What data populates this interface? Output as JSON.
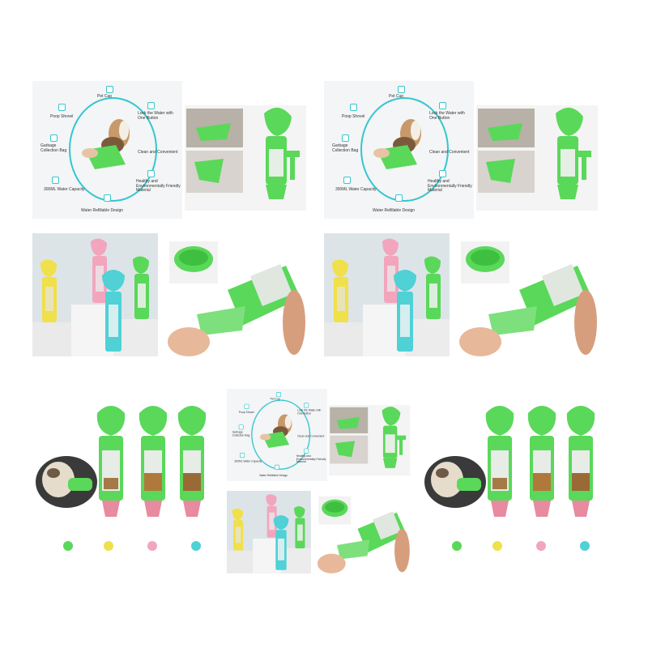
{
  "colors": {
    "green": "#5ad85a",
    "yellow": "#f0e04a",
    "pink": "#f2a6bd",
    "teal": "#4fd1d6",
    "accent": "#35c6cf"
  },
  "features": {
    "pet_cup": "Pet Cup",
    "lock_water": "Lock the Water with One Button",
    "poop_shovel": "Poop Shovel",
    "clean_convenient": "Clean and Convenient",
    "garbage_bag": "Garbage Collection Bag",
    "healthy_material": "Healthy and Environmentally Friendly Material",
    "capacity": "300ML Water Capacity",
    "refillable": "Water Refillable Design"
  },
  "color_swatches": [
    "green",
    "yellow",
    "pink",
    "teal"
  ]
}
